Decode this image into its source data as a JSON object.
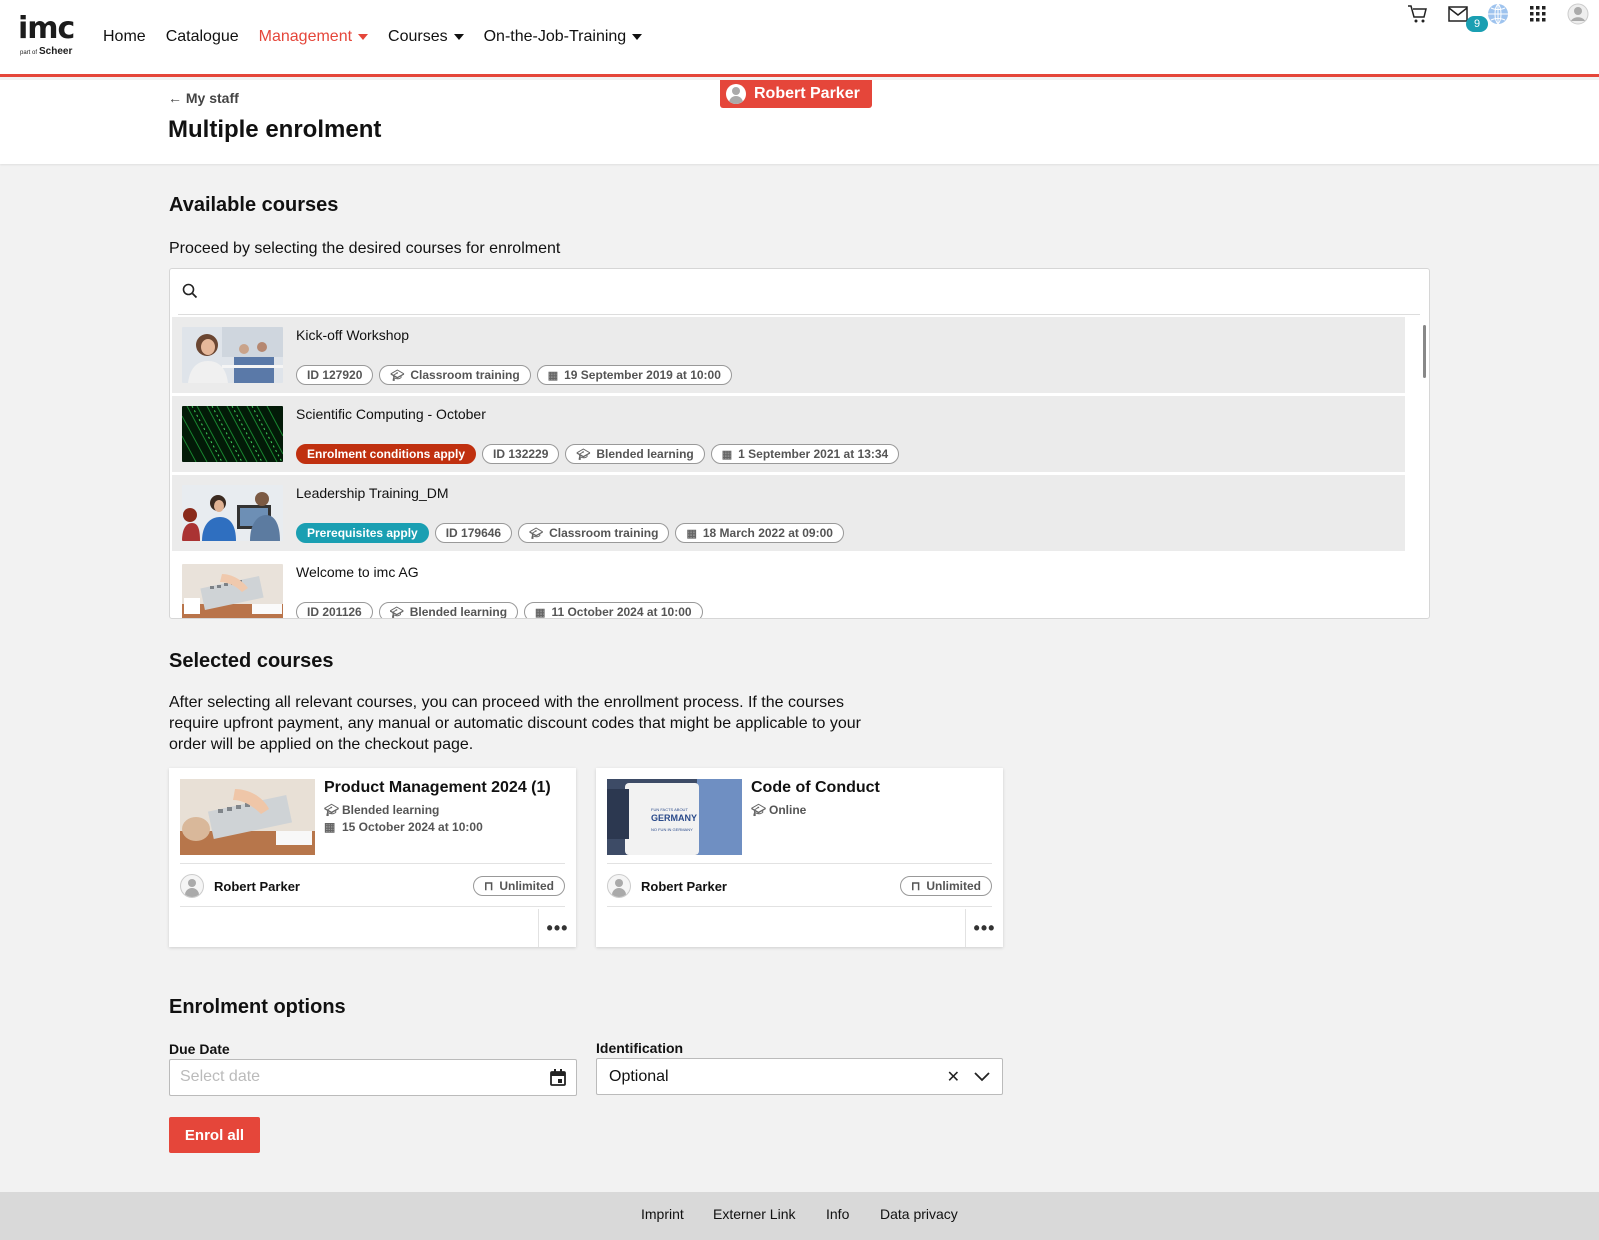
{
  "header": {
    "logo_text": "imc",
    "logo_sub_small": "part of",
    "logo_sub": "Scheer",
    "nav": [
      {
        "label": "Home",
        "dropdown": false,
        "active": false
      },
      {
        "label": "Catalogue",
        "dropdown": false,
        "active": false
      },
      {
        "label": "Management",
        "dropdown": true,
        "active": true
      },
      {
        "label": "Courses",
        "dropdown": true,
        "active": false
      },
      {
        "label": "On-the-Job-Training",
        "dropdown": true,
        "active": false
      }
    ],
    "icons": [
      "cart-icon",
      "mail-icon",
      "globe-icon",
      "apps-grid-icon",
      "profile-avatar-icon"
    ],
    "mail_count": "9"
  },
  "titleband": {
    "back_arrow": "←",
    "back_label": "My staff",
    "title": "Multiple enrolment",
    "user_name": "Robert Parker"
  },
  "available": {
    "heading": "Available courses",
    "instructions": "Proceed by selecting the desired courses for enrolment",
    "search_placeholder": "",
    "courses": [
      {
        "title": "Kick-off Workshop",
        "condition": "",
        "id": "ID 127920",
        "type": "Classroom training",
        "date": "19 September 2019 at 10:00",
        "selected": true
      },
      {
        "title": "Scientific Computing - October",
        "condition": "Enrolment conditions apply",
        "id": "ID 132229",
        "type": "Blended learning",
        "date": "1 September 2021 at 13:34",
        "selected": true
      },
      {
        "title": "Leadership Training_DM",
        "condition": "Prerequisites apply",
        "id": "ID 179646",
        "type": "Classroom training",
        "date": "18 March 2022 at 09:00",
        "selected": true
      },
      {
        "title": "Welcome to imc AG",
        "condition": "",
        "id": "ID 201126",
        "type": "Blended learning",
        "date": "11 October 2024 at 10:00",
        "selected": false
      }
    ]
  },
  "selected": {
    "heading": "Selected courses",
    "description_lines": [
      "After selecting all relevant courses, you can proceed with the enrollment process. If the courses",
      "require upfront payment, any manual or automatic discount codes that might be applicable to your",
      "order will be applied on the checkout page."
    ],
    "cards": [
      {
        "title": "Product Management 2024 (1)",
        "type": "Blended learning",
        "date": "15 October 2024 at 10:00",
        "user": "Robert Parker",
        "seats": "Unlimited",
        "more": "•••"
      },
      {
        "title": "Code of Conduct",
        "type": "Online",
        "date": "",
        "user": "Robert Parker",
        "seats": "Unlimited",
        "more": "•••"
      }
    ]
  },
  "options": {
    "heading": "Enrolment options",
    "due_date_label": "Due Date",
    "due_date_placeholder": "Select date",
    "due_date_value": "",
    "identification_label": "Identification",
    "identification_value": "Optional",
    "clear_glyph": "✕",
    "enrol_button": "Enrol all"
  },
  "footer": {
    "links": [
      "Imprint",
      "Externer Link",
      "Info",
      "Data privacy"
    ]
  },
  "colors": {
    "accent": "#e5463a",
    "teal": "#1a9fb2",
    "condition_red": "#c0300f"
  }
}
